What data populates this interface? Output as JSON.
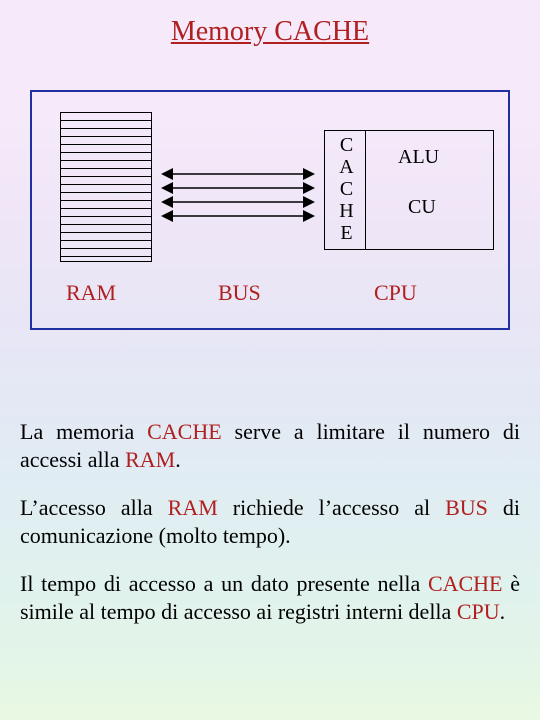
{
  "title": "Memory CACHE",
  "diagram": {
    "ram_label": "RAM",
    "bus_label": "BUS",
    "cpu_label": "CPU",
    "cache_letters": [
      "C",
      "A",
      "C",
      "H",
      "E"
    ],
    "alu": "ALU",
    "cu": "CU"
  },
  "para1": {
    "a": "La memoria ",
    "b": "CACHE",
    "c": " serve a limitare il numero di accessi alla ",
    "d": "RAM",
    "e": "."
  },
  "para2": {
    "a": "L’accesso alla ",
    "b": "RAM",
    "c": " richiede l’accesso al ",
    "d": "BUS",
    "e": " di comunicazione (molto tempo)."
  },
  "para3": {
    "a": "Il tempo di accesso a un dato presente nella ",
    "b": "CACHE",
    "c": " è simile al tempo di accesso ai registri interni della ",
    "d": "CPU",
    "e": "."
  }
}
